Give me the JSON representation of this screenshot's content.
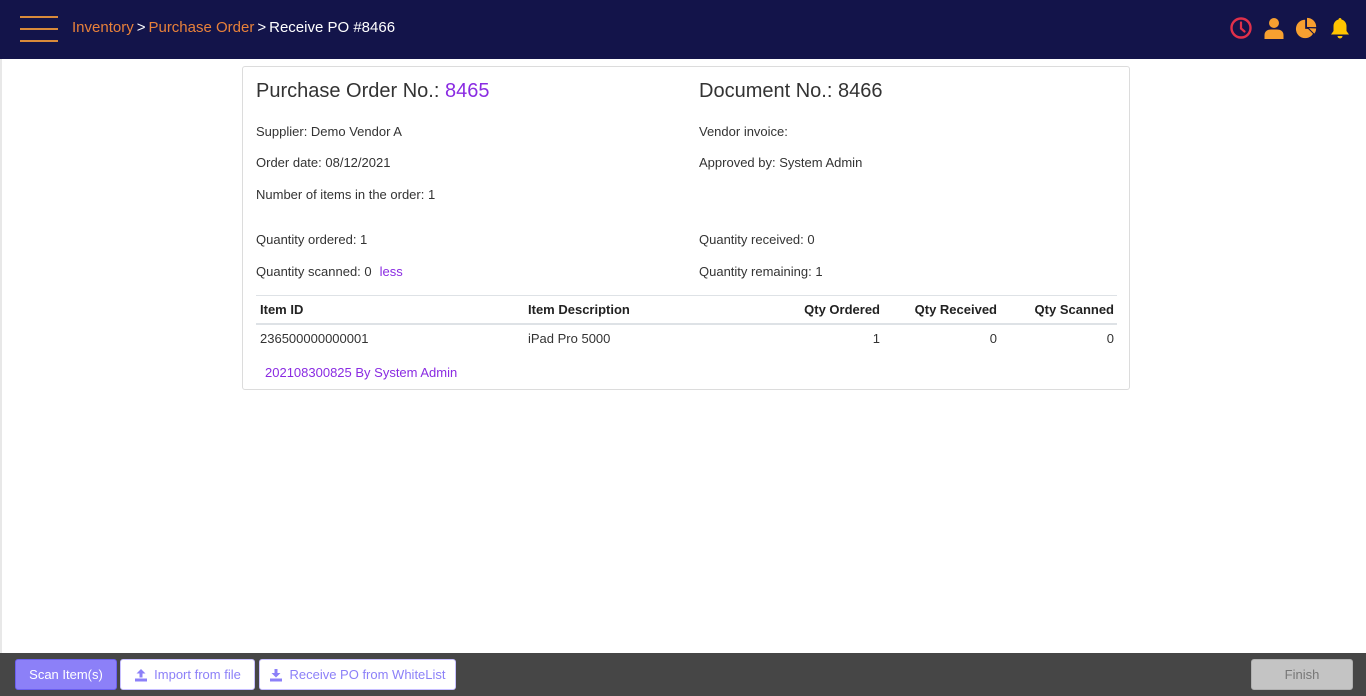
{
  "header": {
    "breadcrumb": {
      "items": [
        "Inventory",
        "Purchase Order"
      ],
      "separator": ">",
      "current": "Receive PO #8466"
    },
    "icons": [
      "clock-icon",
      "user-icon",
      "pie-chart-icon",
      "bell-icon"
    ]
  },
  "order": {
    "po_label": "Purchase Order No.: ",
    "po_number": "8465",
    "doc_label": "Document No.: ",
    "doc_number": "8466",
    "supplier": "Supplier: Demo Vendor A",
    "order_date": "Order date: 08/12/2021",
    "item_count": "Number of items in the order: 1",
    "vendor_invoice": "Vendor invoice:",
    "approved_by": "Approved by: System Admin",
    "qty_ordered": "Quantity ordered: 1",
    "qty_received": "Quantity received: 0",
    "qty_scanned": "Quantity scanned: 0",
    "qty_remaining": "Quantity remaining: 1",
    "less_link": "less"
  },
  "table": {
    "columns": [
      "Item ID",
      "Item Description",
      "Qty Ordered",
      "Qty Received",
      "Qty Scanned"
    ],
    "rows": [
      {
        "item_id": "236500000000001",
        "description": "iPad Pro 5000",
        "qty_ordered": "1",
        "qty_received": "0",
        "qty_scanned": "0"
      }
    ]
  },
  "scan_log": "202108300825 By System Admin",
  "footer": {
    "scan_label": "Scan Item(s)",
    "import_label": "Import from file",
    "whitelist_label": "Receive PO from WhiteList",
    "finish_label": "Finish"
  },
  "colors": {
    "topbar": "#13144a",
    "accent_orange": "#e8813a",
    "accent_purple": "#8a2be2",
    "button_purple": "#8c80f8",
    "clock_red": "#e0304a",
    "icon_orange": "#f7a030",
    "bell_yellow": "#ffc400"
  }
}
